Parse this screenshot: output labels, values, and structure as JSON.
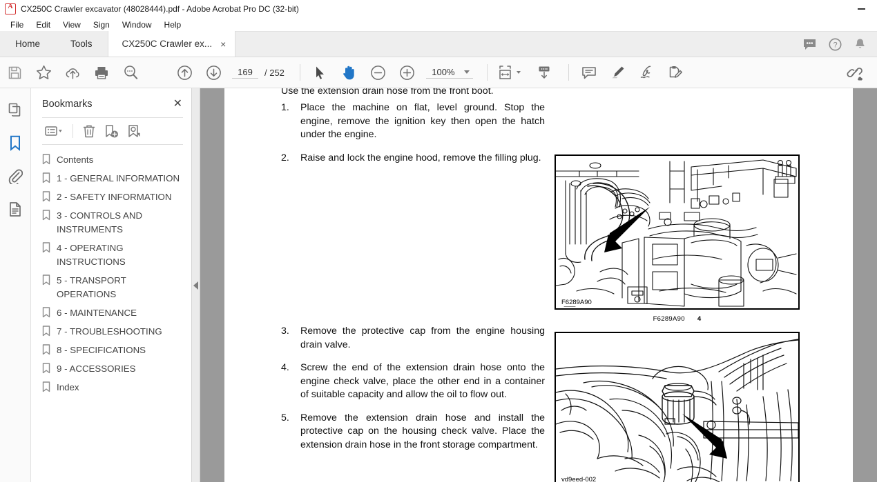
{
  "window": {
    "title": "CX250C Crawler excavator (48028444).pdf - Adobe Acrobat Pro DC (32-bit)",
    "app_icon": "acrobat-icon",
    "minimize_label": "—"
  },
  "menubar": {
    "items": [
      "File",
      "Edit",
      "View",
      "Sign",
      "Window",
      "Help"
    ]
  },
  "tabbar": {
    "home_label": "Home",
    "tools_label": "Tools",
    "document_tab_label": "CX250C Crawler ex...",
    "close_label": "×",
    "right_icons": [
      "chat-bubble-icon",
      "help-circle-icon",
      "bell-icon"
    ]
  },
  "toolbar": {
    "left_icons": [
      "save-icon",
      "star-icon",
      "upload-cloud-icon",
      "print-icon",
      "search-zoom-icon"
    ],
    "previous_page_icon": "arrow-up-circle-icon",
    "next_page_icon": "arrow-down-circle-icon",
    "page_number": "169",
    "page_total": "/ 252",
    "select_tool_icon": "cursor-arrow-icon",
    "hand_tool_icon": "hand-icon",
    "zoom_out_icon": "zoom-out-circle-icon",
    "zoom_in_icon": "zoom-in-circle-icon",
    "zoom_level": "100%",
    "fit_page_icon": "fit-page-icon",
    "scroll_mode_icon": "scroll-mode-icon",
    "comment_icon": "comment-icon",
    "highlight_icon": "highlighter-icon",
    "sign_icon": "sign-icon",
    "fill_sign_icon": "fill-and-sign-icon",
    "share_icon": "share-link-icon",
    "accent_color": "#2176c7"
  },
  "rail": {
    "items": [
      {
        "name": "page-thumbnails",
        "icon": "page-thumbnails-icon",
        "active": false
      },
      {
        "name": "bookmarks",
        "icon": "bookmark-icon",
        "active": true
      },
      {
        "name": "attachments",
        "icon": "paperclip-icon",
        "active": false
      },
      {
        "name": "document-info",
        "icon": "document-icon",
        "active": false
      }
    ]
  },
  "bookmarks_panel": {
    "title": "Bookmarks",
    "close_label": "✕",
    "tools": [
      "options-list-icon",
      "delete-bookmark-icon",
      "new-bookmark-icon",
      "find-bookmark-icon"
    ],
    "items": [
      {
        "label": "Contents"
      },
      {
        "label": "1 - GENERAL INFORMATION"
      },
      {
        "label": "2 - SAFETY INFORMATION"
      },
      {
        "label": "3 - CONTROLS AND INSTRUMENTS"
      },
      {
        "label": "4 - OPERATING INSTRUCTIONS"
      },
      {
        "label": "5 - TRANSPORT OPERATIONS"
      },
      {
        "label": "6 - MAINTENANCE"
      },
      {
        "label": "7 - TROUBLESHOOTING"
      },
      {
        "label": "8 - SPECIFICATIONS"
      },
      {
        "label": "9 - ACCESSORIES"
      },
      {
        "label": "Index"
      }
    ]
  },
  "splitter": {
    "collapse_icon": "collapse-left-arrow-icon"
  },
  "document": {
    "clipped_top_line": "Use the extension drain hose from the front boot.",
    "steps": [
      {
        "number": "1.",
        "text": "Place the machine on flat, level ground. Stop the engine, remove the ignition key then open the hatch under the engine."
      },
      {
        "number": "2.",
        "text": "Raise and lock the engine hood, remove the filling plug."
      },
      {
        "number": "3.",
        "text": "Remove the protective cap from the engine housing drain valve."
      },
      {
        "number": "4.",
        "text": "Screw the end of the extension drain hose onto the engine check valve, place the other end in a container of suitable capacity and allow the oil to flow out."
      },
      {
        "number": "5.",
        "text": "Remove the extension drain hose and install the protective cap on the housing check valve. Place the extension drain hose in the front storage compartment."
      }
    ],
    "figures": [
      {
        "id_in_image": "F6289A90",
        "caption_id": "F6289A90",
        "caption_number": "4",
        "alt": "engine-compartment-line-drawing"
      },
      {
        "id_in_image": "vd9eed-002",
        "caption_id": "",
        "caption_number": "",
        "alt": "drain-valve-cap-line-drawing"
      }
    ]
  }
}
